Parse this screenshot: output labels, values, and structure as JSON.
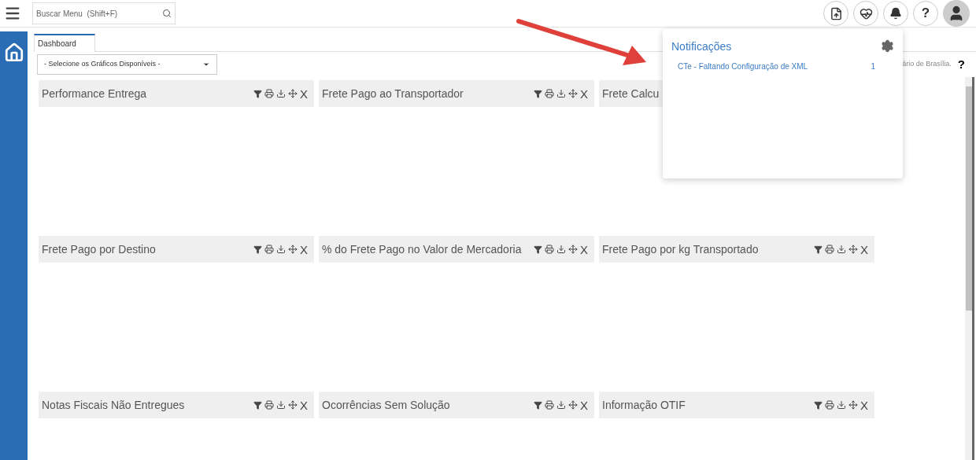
{
  "search": {
    "placeholder": "Buscar Menu  (Shift+F)"
  },
  "tabs": [
    {
      "label": "Dashboard",
      "selected": true
    }
  ],
  "chart_select": {
    "value": "- Selecione os Gráficos Disponíveis -"
  },
  "timezone_note": "ário de Brasília.",
  "help": "?",
  "panels": [
    {
      "title": "Performance Entrega",
      "close": "X"
    },
    {
      "title": "Frete Pago ao Transportador",
      "close": "X"
    },
    {
      "title": "Frete Calcu"
    },
    {
      "title": "Frete Pago por Destino",
      "close": "X"
    },
    {
      "title": "% do Frete Pago no Valor de Mercadoria",
      "close": "X"
    },
    {
      "title": "Frete Pago por kg Transportado",
      "close": "X"
    },
    {
      "title": "Notas Fiscais Não Entregues",
      "close": "X"
    },
    {
      "title": "Ocorrências Sem Solução",
      "close": "X"
    },
    {
      "title": "Informação OTIF",
      "close": "X"
    }
  ],
  "header_help": "?",
  "notifications": {
    "title": "Notificações",
    "items": [
      {
        "label": "CTe - Faltando Configuração de XML",
        "count": "1"
      }
    ]
  }
}
